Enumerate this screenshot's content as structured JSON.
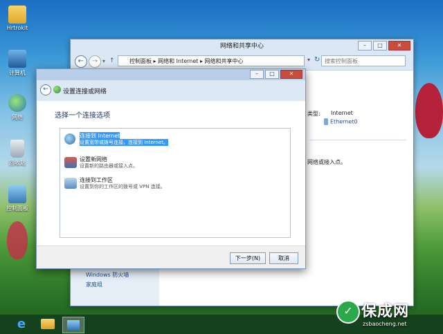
{
  "desktop": {
    "icons": [
      {
        "label": "Hrtrokit",
        "icon": "folder-icon"
      },
      {
        "label": "计算机",
        "icon": "computer-icon"
      },
      {
        "label": "网络",
        "icon": "network-icon"
      },
      {
        "label": "回收站",
        "icon": "recycle-bin-icon"
      },
      {
        "label": "控制面板",
        "icon": "control-panel-icon"
      }
    ]
  },
  "main_window": {
    "title": "网络和共享中心",
    "breadcrumb": [
      "控制面板",
      "网络和 Internet",
      "网络和共享中心"
    ],
    "search_placeholder": "搜索控制面板",
    "connection_type_label": "类型:",
    "connection_type_value": "Internet",
    "connection_value": "Ethernet0",
    "partial_text": "网络或接入点。",
    "see_also": [
      "Windows 防火墙",
      "家庭组"
    ]
  },
  "dialog": {
    "title": "设置连接或网络",
    "choose_label": "选择一个连接选项",
    "options": [
      {
        "title": "连接到 Internet",
        "desc": "设置宽带或拨号连接，连接到 Internet。",
        "selected": true
      },
      {
        "title": "设置新网络",
        "desc": "设置新的路由器或接入点。",
        "selected": false
      },
      {
        "title": "连接到工作区",
        "desc": "设置到你的工作区的拨号或 VPN 连接。",
        "selected": false
      }
    ],
    "next_button": "下一步(N)",
    "cancel_button": "取消"
  },
  "watermark": {
    "text": "保成网",
    "url": "zsbaocheng.net"
  },
  "colors": {
    "selection": "#3399ff",
    "titlebar": "#dbe7f4",
    "close": "#c74c3c"
  }
}
